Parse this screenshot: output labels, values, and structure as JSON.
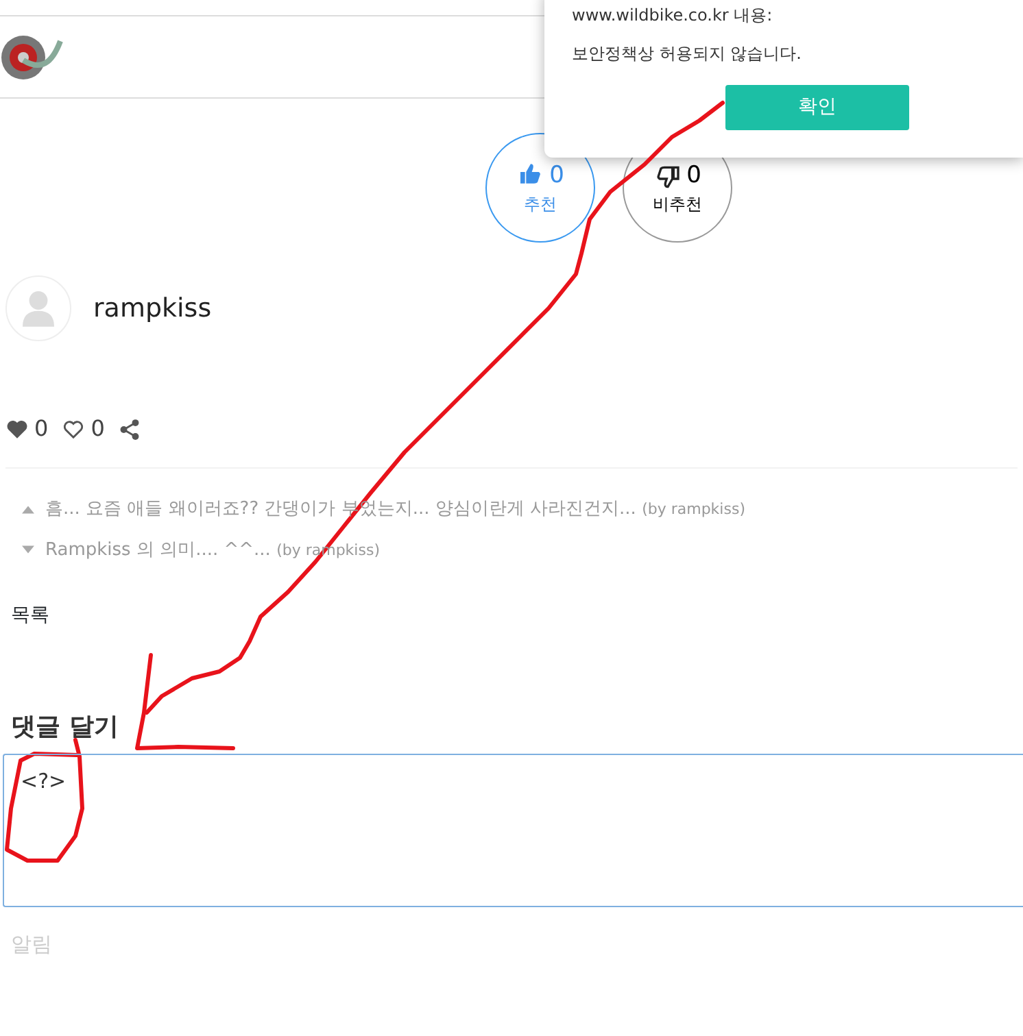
{
  "dialog": {
    "origin": "www.wildbike.co.kr 내용:",
    "message": "보안정책상 허용되지 않습니다.",
    "button": "확인"
  },
  "votes": [
    {
      "kind": "up",
      "count": "0",
      "label": "추천"
    },
    {
      "kind": "down",
      "count": "0",
      "label": "비추천"
    }
  ],
  "author": {
    "name": "rampkiss"
  },
  "reactions": [
    {
      "kind": "like",
      "count": "0"
    },
    {
      "kind": "favorite",
      "count": "0"
    },
    {
      "kind": "share"
    }
  ],
  "nav_links": [
    {
      "kind": "prev",
      "title": "흠... 요즘 애들 왜이러죠?? 간댕이가 부었는지... 양심이란게 사라진건지...",
      "by": "(by rampkiss)"
    },
    {
      "kind": "next",
      "title": "Rampkiss 의 의미.... ^^...",
      "by": "(by rampkiss)"
    }
  ],
  "list_link": "목록",
  "comment": {
    "heading": "댓글 달기",
    "value": "<?>"
  },
  "notice": "알림"
}
